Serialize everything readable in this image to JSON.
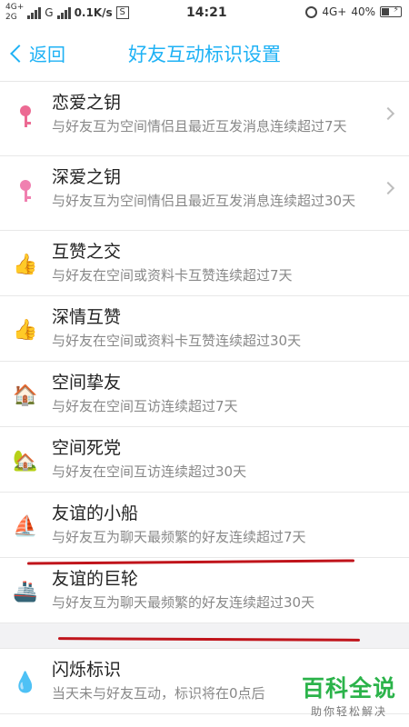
{
  "status_bar": {
    "net_top": "4G+",
    "net_bottom": "2G",
    "carrier_letter": "G",
    "speed": "0.1K/s",
    "s_icon": "S",
    "time": "14:21",
    "net_right": "4G+",
    "battery": "40%"
  },
  "header": {
    "back_label": "返回",
    "title": "好友互动标识设置"
  },
  "items": [
    {
      "name": "恋爱之钥",
      "desc": "与好友互为空间情侣且最近互发消息连续超过7天",
      "icon": "love-key-icon",
      "arrow": true
    },
    {
      "name": "深爱之钥",
      "desc": "与好友互为空间情侣且最近互发消息连续超过30天",
      "icon": "deep-love-key-icon",
      "arrow": true
    },
    {
      "name": "互赞之交",
      "desc": "与好友在空间或资料卡互赞连续超过7天",
      "icon": "thumbs-up-icon",
      "arrow": false
    },
    {
      "name": "深情互赞",
      "desc": "与好友在空间或资料卡互赞连续超过30天",
      "icon": "thumbs-up-heart-icon",
      "arrow": false
    },
    {
      "name": "空间挚友",
      "desc": "与好友在空间互访连续超过7天",
      "icon": "house-icon",
      "arrow": false
    },
    {
      "name": "空间死党",
      "desc": "与好友在空间互访连续超过30天",
      "icon": "house-gold-icon",
      "arrow": false
    },
    {
      "name": "友谊的小船",
      "desc": "与好友互为聊天最频繁的好友连续超过7天",
      "icon": "sailboat-icon",
      "arrow": false
    },
    {
      "name": "友谊的巨轮",
      "desc": "与好友互为聊天最频繁的好友连续超过30天",
      "icon": "ship-icon",
      "arrow": false
    },
    {
      "name": "闪烁标识",
      "desc": "当天未与好友互动，标识将在0点后",
      "icon": "flash-drop-icon",
      "arrow": false
    }
  ],
  "watermark": {
    "main": "百科全说",
    "sub": "助你轻松解决"
  },
  "colors": {
    "accent": "#1fb2f5",
    "underline": "#c0141b",
    "watermark": "#2bb34a"
  }
}
